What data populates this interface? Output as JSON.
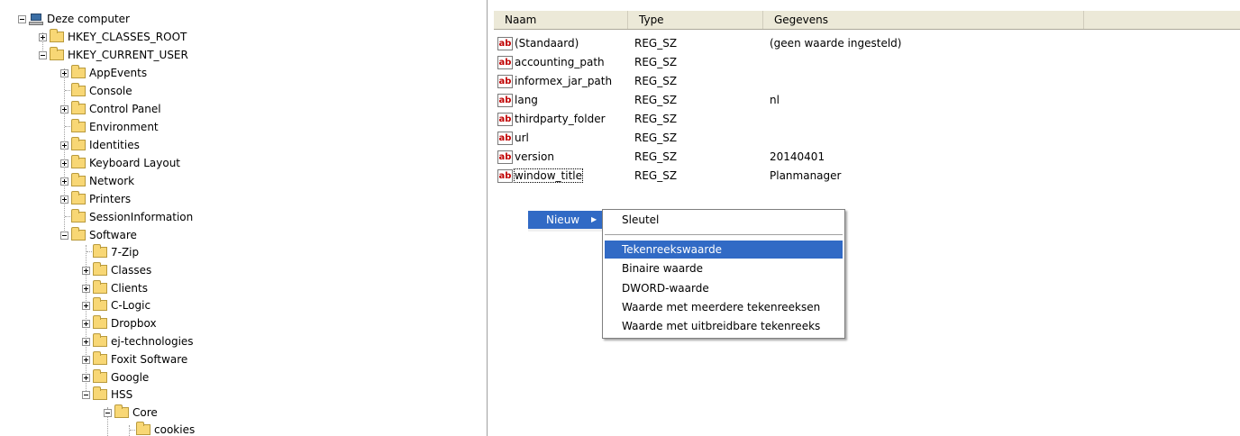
{
  "tree": {
    "root": "Deze computer",
    "hkcr": "HKEY_CLASSES_ROOT",
    "hkcu": "HKEY_CURRENT_USER",
    "appevents": "AppEvents",
    "console": "Console",
    "control_panel": "Control Panel",
    "environment": "Environment",
    "identities": "Identities",
    "keyboard_layout": "Keyboard Layout",
    "network": "Network",
    "printers": "Printers",
    "session_information": "SessionInformation",
    "software": "Software",
    "zip7": "7-Zip",
    "classes": "Classes",
    "clients": "Clients",
    "clogic": "C-Logic",
    "dropbox": "Dropbox",
    "ej": "ej-technologies",
    "foxit": "Foxit Software",
    "google": "Google",
    "hss": "HSS",
    "core": "Core",
    "cookies": "cookies"
  },
  "values": {
    "columns": {
      "name": "Naam",
      "type": "Type",
      "data": "Gegevens"
    },
    "icon_text": "ab",
    "rows": [
      {
        "name": "(Standaard)",
        "type": "REG_SZ",
        "data": "(geen waarde ingesteld)"
      },
      {
        "name": "accounting_path",
        "type": "REG_SZ",
        "data": ""
      },
      {
        "name": "informex_jar_path",
        "type": "REG_SZ",
        "data": ""
      },
      {
        "name": "lang",
        "type": "REG_SZ",
        "data": "nl"
      },
      {
        "name": "thirdparty_folder",
        "type": "REG_SZ",
        "data": ""
      },
      {
        "name": "url",
        "type": "REG_SZ",
        "data": ""
      },
      {
        "name": "version",
        "type": "REG_SZ",
        "data": "20140401"
      },
      {
        "name": "window_title",
        "type": "REG_SZ",
        "data": "Planmanager"
      }
    ]
  },
  "context_menu": {
    "new_label": "Nieuw",
    "arrow": "▶",
    "key": "Sleutel",
    "string_value": "Tekenreekswaarde",
    "binary_value": "Binaire waarde",
    "dword_value": "DWORD-waarde",
    "multi_string_value": "Waarde met meerdere tekenreeksen",
    "expandable_string_value": "Waarde met uitbreidbare tekenreeks"
  },
  "colors": {
    "highlight": "#316ac5",
    "folder": "#f8d775",
    "header": "#ece9d8"
  }
}
